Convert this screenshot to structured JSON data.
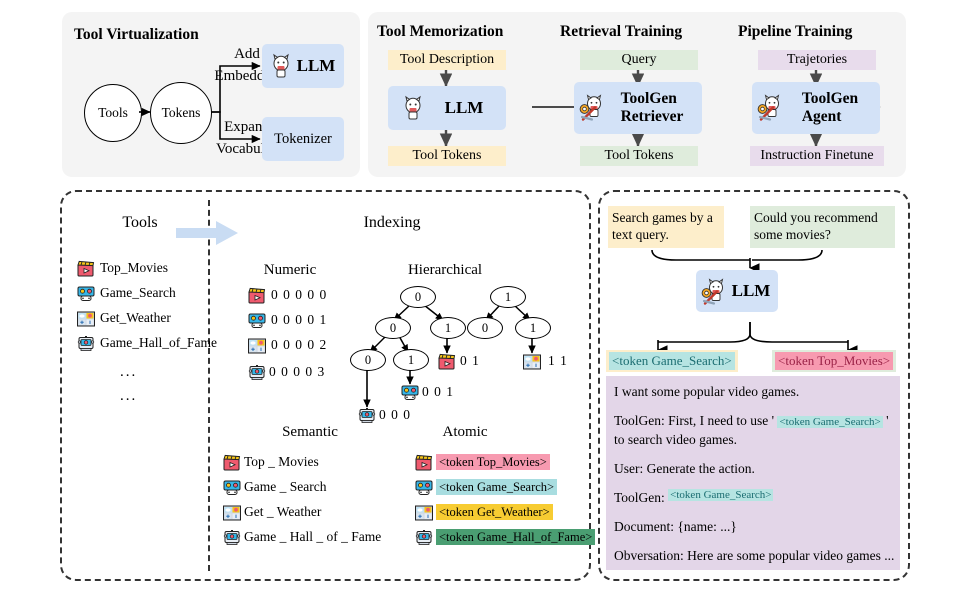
{
  "top_left": {
    "title": "Tool Virtualization",
    "nodes": {
      "tools": "Tools",
      "tokens": "Tokens"
    },
    "edges": [
      {
        "line1": "Add",
        "line2": "Embedding"
      },
      {
        "line1": "Expand",
        "line2": "Vocabulary"
      }
    ],
    "targets": [
      {
        "label": "LLM",
        "icon": "llama-icon"
      },
      {
        "label": "Tokenizer",
        "icon": "none"
      }
    ]
  },
  "top_right": {
    "stages": [
      {
        "title": "Tool Memorization",
        "input": "Tool Description",
        "model": "LLM",
        "model_line2": "",
        "output": "Tool Tokens",
        "color": "#fdeecb",
        "icon": "llama-icon"
      },
      {
        "title": "Retrieval Training",
        "input": "Query",
        "model": "ToolGen",
        "model_line2": "Retriever",
        "output": "Tool Tokens",
        "color": "#dfecdc",
        "icon": "llama-tools-icon"
      },
      {
        "title": "Pipeline Training",
        "input": "Trajetories",
        "model": "ToolGen",
        "model_line2": "Agent",
        "output": "Instruction Finetune",
        "color": "#e8dcec",
        "icon": "llama-tools-icon"
      }
    ]
  },
  "bottom_left": {
    "tools_heading": "Tools",
    "indexing_heading": "Indexing",
    "arrow_icon": "block-arrow-right-icon",
    "tools": [
      {
        "name": "Top_Movies",
        "icon": "clapperboard-icon"
      },
      {
        "name": "Game_Search",
        "icon": "video-game-icon"
      },
      {
        "name": "Get_Weather",
        "icon": "weather-widget-icon"
      },
      {
        "name": "Game_Hall_of_Fame",
        "icon": "arcade-machine-icon"
      }
    ],
    "tools_ellipsis": [
      "...",
      "..."
    ],
    "numeric": {
      "heading": "Numeric",
      "rows": [
        {
          "icon": "clapperboard-icon",
          "code": "0 0 0 0 0"
        },
        {
          "icon": "video-game-icon",
          "code": "0 0 0 0 1"
        },
        {
          "icon": "weather-widget-icon",
          "code": "0 0 0 0 2"
        },
        {
          "icon": "arcade-machine-icon",
          "code": "0 0 0 0 3"
        }
      ]
    },
    "hierarchical": {
      "heading": "Hierarchical",
      "nodes": [
        "0",
        "1",
        "0",
        "1",
        "0",
        "1",
        "0",
        "1"
      ],
      "leaves": [
        {
          "icon": "clapperboard-icon",
          "code": "0 1"
        },
        {
          "icon": "weather-widget-icon",
          "code": "1 1"
        },
        {
          "icon": "video-game-icon",
          "code": "0 0 1"
        },
        {
          "icon": "arcade-machine-icon",
          "code": "0 0 0"
        }
      ]
    },
    "semantic": {
      "heading": "Semantic",
      "rows": [
        {
          "icon": "clapperboard-icon",
          "text": "Top _ Movies"
        },
        {
          "icon": "video-game-icon",
          "text": "Game _ Search"
        },
        {
          "icon": "weather-widget-icon",
          "text": "Get _ Weather"
        },
        {
          "icon": "arcade-machine-icon",
          "text": "Game _ Hall _ of _ Fame"
        }
      ]
    },
    "atomic": {
      "heading": "Atomic",
      "rows": [
        {
          "icon": "clapperboard-icon",
          "token": "<token Top_Movies>",
          "color": "#f79ab0"
        },
        {
          "icon": "video-game-icon",
          "token": "<token Game_Search>",
          "color": "#a8dde0"
        },
        {
          "icon": "weather-widget-icon",
          "token": "<token Get_Weather>",
          "color": "#f7cc32"
        },
        {
          "icon": "arcade-machine-icon",
          "token": "<token Game_Hall_of_Fame>",
          "color": "#4a9e72"
        }
      ]
    }
  },
  "bottom_right": {
    "queries": [
      {
        "text": "Search games by a text query.",
        "color": "#fdeecb"
      },
      {
        "text": "Could you recommend some movies?",
        "color": "#dfecdc"
      }
    ],
    "model": {
      "label": "LLM",
      "icon": "llama-tools-icon"
    },
    "outputs": [
      {
        "token": "<token Game_Search>",
        "fg": "#1b6d71",
        "bg": "#b6e4e2",
        "outer": "#fdeecb"
      },
      {
        "token": "<token Top_Movies>",
        "fg": "#9b2247",
        "bg": "#f79ab0",
        "outer": "#dfecdc"
      }
    ],
    "conversation": [
      {
        "parts": [
          {
            "t": "I want some popular video games.",
            "k": "plain"
          }
        ]
      },
      {
        "parts": [
          {
            "t": "ToolGen: First, I need to use ' ",
            "k": "plain"
          },
          {
            "t": "<token Game_Search>",
            "k": "token"
          },
          {
            "t": " '",
            "k": "plain"
          }
        ]
      },
      {
        "parts": [
          {
            "t": "to search video games.",
            "k": "plain"
          }
        ]
      },
      {
        "parts": [
          {
            "t": "User: Generate the action.",
            "k": "plain"
          }
        ]
      },
      {
        "parts": [
          {
            "t": "ToolGen:  ",
            "k": "plain"
          },
          {
            "t": "<token Game_Search>",
            "k": "token"
          }
        ]
      },
      {
        "parts": [
          {
            "t": "Document: {name: ...}",
            "k": "plain"
          }
        ]
      },
      {
        "parts": [
          {
            "t": "Obversation: Here are some popular video games ...",
            "k": "plain"
          }
        ]
      }
    ]
  }
}
